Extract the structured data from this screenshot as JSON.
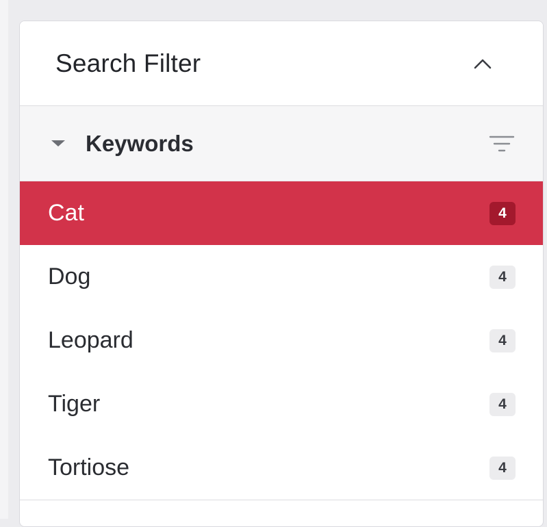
{
  "panel": {
    "title": "Search Filter",
    "collapse_icon": "chevron-up-icon"
  },
  "section": {
    "title": "Keywords",
    "expand_icon": "caret-down-icon",
    "filter_icon": "filter-icon"
  },
  "keywords": [
    {
      "label": "Cat",
      "count": "4",
      "active": true
    },
    {
      "label": "Dog",
      "count": "4",
      "active": false
    },
    {
      "label": "Leopard",
      "count": "4",
      "active": false
    },
    {
      "label": "Tiger",
      "count": "4",
      "active": false
    },
    {
      "label": "Tortiose",
      "count": "4",
      "active": false
    }
  ],
  "colors": {
    "active_bg": "#d2334a",
    "active_badge_bg": "#a3192d",
    "badge_bg": "#ececee"
  }
}
